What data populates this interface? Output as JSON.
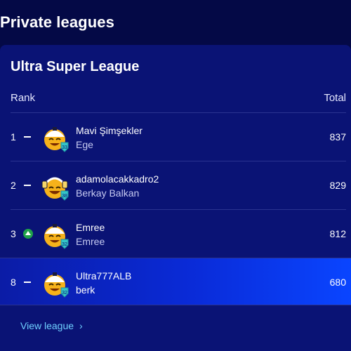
{
  "page": {
    "title": "Private leagues"
  },
  "league": {
    "name": "Ultra Super League",
    "columns": {
      "rank": "Rank",
      "total": "Total"
    },
    "rows": [
      {
        "rank": "1",
        "trend": "same",
        "username": "Mavi Şimşekler",
        "fullname": "Ege",
        "total": "837",
        "level": "33",
        "avatar": "default-avatar-icon"
      },
      {
        "rank": "2",
        "trend": "same",
        "username": "adamolacakkadro2",
        "fullname": "Berkay Balkan",
        "total": "829",
        "level": "38",
        "avatar": "headphones-avatar-icon"
      },
      {
        "rank": "3",
        "trend": "up",
        "username": "Emree",
        "fullname": "Emree",
        "total": "812",
        "level": "32",
        "avatar": "default-avatar-icon"
      },
      {
        "rank": "8",
        "trend": "same",
        "username": "Ultra777ALB",
        "fullname": "berk",
        "total": "680",
        "level": "32",
        "avatar": "default-avatar-icon",
        "highlighted": true
      }
    ],
    "view_league_label": "View league"
  },
  "colors": {
    "background": "#040946",
    "card": "#0a1375",
    "highlight": "#0a45ff",
    "link": "#6fd0ff",
    "trend_up": "#1fa24a"
  }
}
